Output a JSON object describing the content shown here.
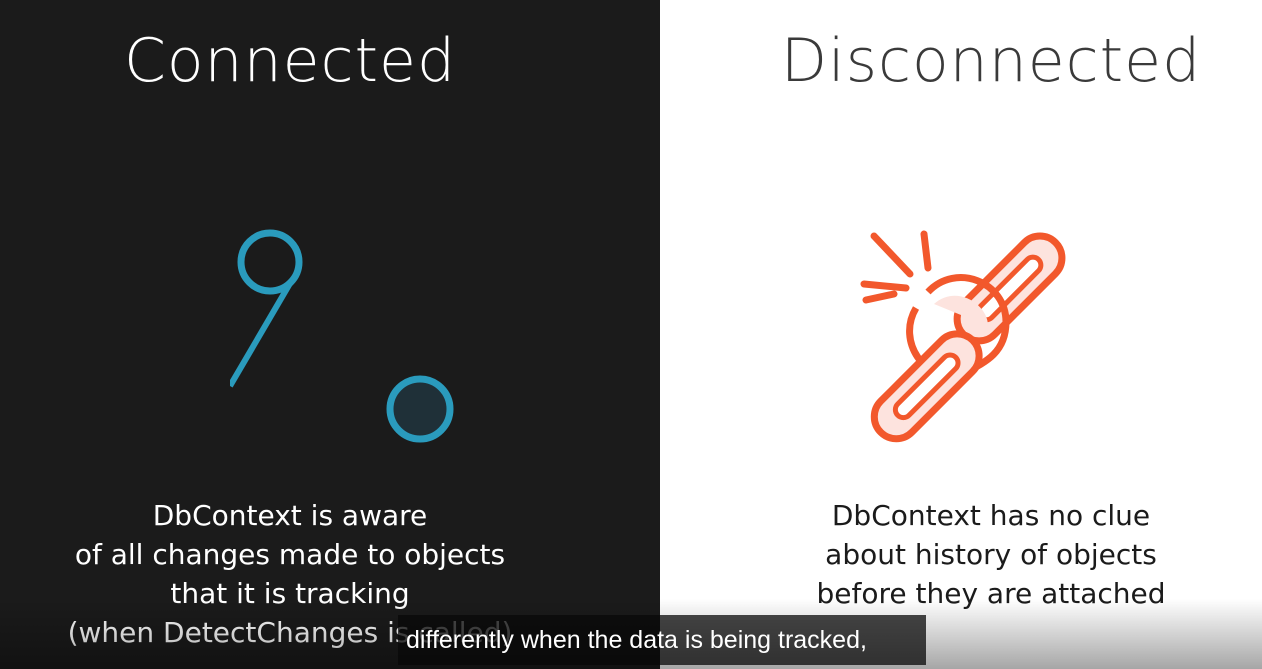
{
  "left_panel": {
    "title": "Connected",
    "description": [
      "DbContext is aware",
      "of all changes made to objects",
      "that it is tracking",
      "(when DetectChanges is called)"
    ],
    "icon": "connected-nodes-icon",
    "accent_color": "#2a9bbd",
    "background_color": "#1b1b1b"
  },
  "right_panel": {
    "title": "Disconnected",
    "description": [
      "DbContext has no clue",
      "about history of objects",
      "before they are attached"
    ],
    "icon": "broken-chain-icon",
    "accent_color": "#f2582c",
    "background_color": "#ffffff"
  },
  "subtitle": {
    "text": "differently when the data is being tracked,"
  }
}
